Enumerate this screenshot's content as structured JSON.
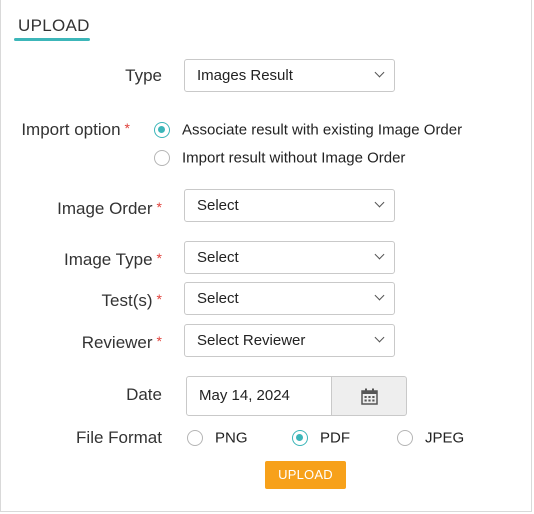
{
  "section": {
    "title": "UPLOAD"
  },
  "fields": {
    "type": {
      "label": "Type",
      "value": "Images Result"
    },
    "import_option": {
      "label": "Import option",
      "required_mark": "*",
      "options": [
        {
          "label": "Associate result with existing Image Order",
          "selected": true
        },
        {
          "label": "Import result without Image Order",
          "selected": false
        }
      ]
    },
    "image_order": {
      "label": "Image Order",
      "required_mark": "*",
      "value": "Select"
    },
    "image_type": {
      "label": "Image Type",
      "required_mark": "*",
      "value": "Select"
    },
    "tests": {
      "label": "Test(s)",
      "required_mark": "*",
      "value": "Select"
    },
    "reviewer": {
      "label": "Reviewer",
      "required_mark": "*",
      "value": "Select Reviewer"
    },
    "date": {
      "label": "Date",
      "value": "May 14, 2024"
    },
    "file_format": {
      "label": "File Format",
      "options": [
        {
          "label": "PNG",
          "selected": false
        },
        {
          "label": "PDF",
          "selected": true
        },
        {
          "label": "JPEG",
          "selected": false
        }
      ]
    }
  },
  "actions": {
    "upload_label": "UPLOAD"
  },
  "colors": {
    "accent": "#3cb6b9",
    "button": "#f7a11a",
    "required": "#e0403a"
  }
}
